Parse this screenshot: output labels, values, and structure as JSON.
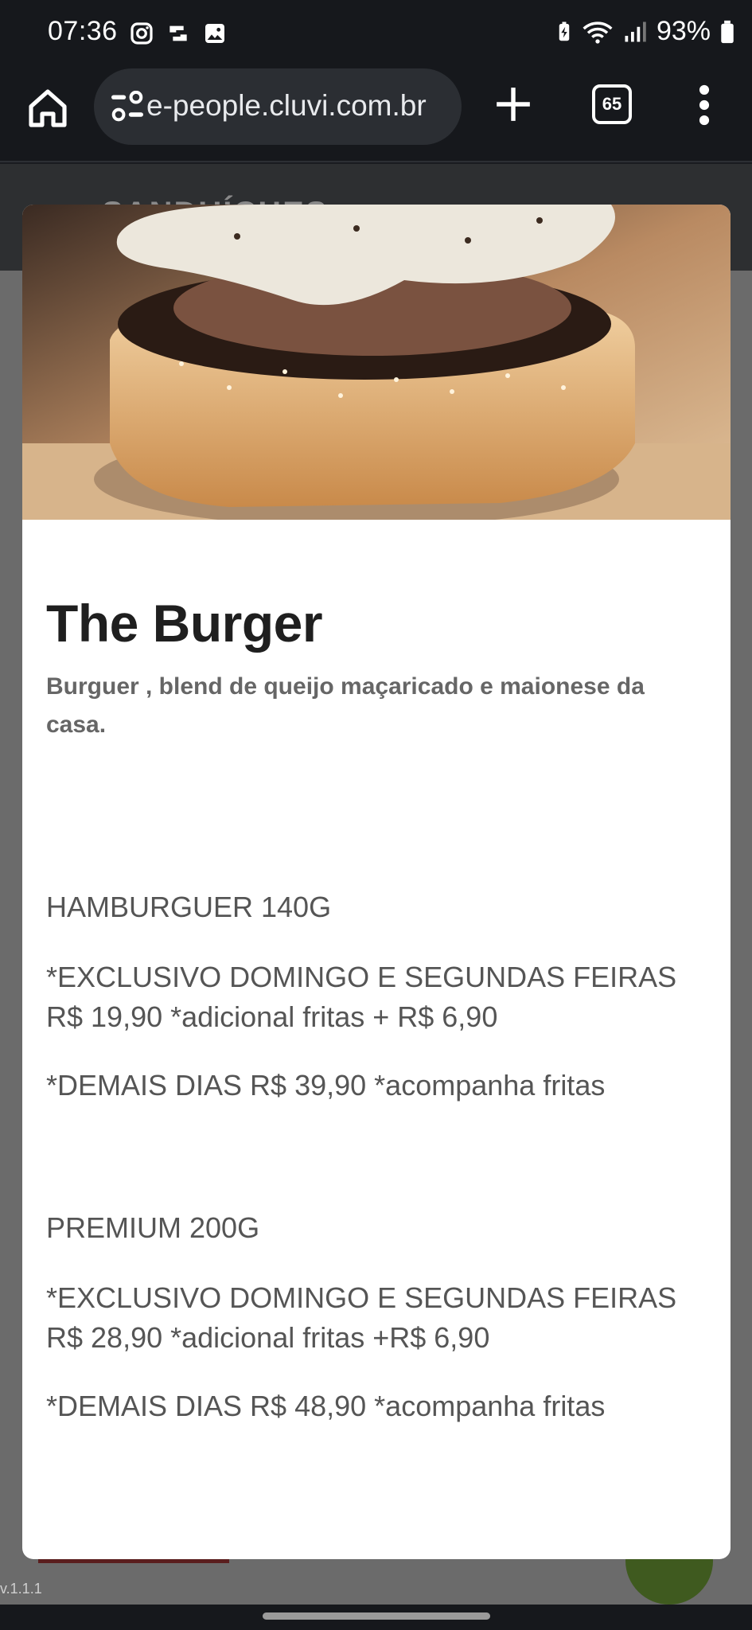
{
  "status_bar": {
    "time": "07:36",
    "battery_percent": "93%"
  },
  "browser": {
    "url": "e-people.cluvi.com.br",
    "tab_count": "65"
  },
  "page": {
    "section_title": "SANDUÍCHES",
    "version": "v.1.1.1"
  },
  "product": {
    "title": "The Burger",
    "description": "Burguer , blend de queijo maçaricado e maionese da casa.",
    "details": [
      "HAMBURGUER 140G",
      "*EXCLUSIVO DOMINGO E SEGUNDAS FEIRAS R$ 19,90 *adicional fritas + R$ 6,90",
      "*DEMAIS DIAS R$ 39,90 *acompanha fritas",
      "PREMIUM 200G",
      "*EXCLUSIVO DOMINGO E SEGUNDAS FEIRAS R$ 28,90 *adicional fritas +R$ 6,90",
      "*DEMAIS DIAS R$ 48,90 *acompanha fritas"
    ]
  },
  "icons": {
    "instagram": "instagram-icon",
    "sync": "sync-icon",
    "gallery": "gallery-icon",
    "battery_saver": "battery-saver-icon",
    "wifi": "wifi-icon",
    "signal": "signal-icon",
    "battery": "battery-icon",
    "home": "home-icon",
    "site_settings": "tune-icon",
    "new_tab": "plus-icon",
    "tabs": "tab-switcher-icon",
    "menu": "more-vert-icon",
    "back": "back-arrow-icon"
  }
}
